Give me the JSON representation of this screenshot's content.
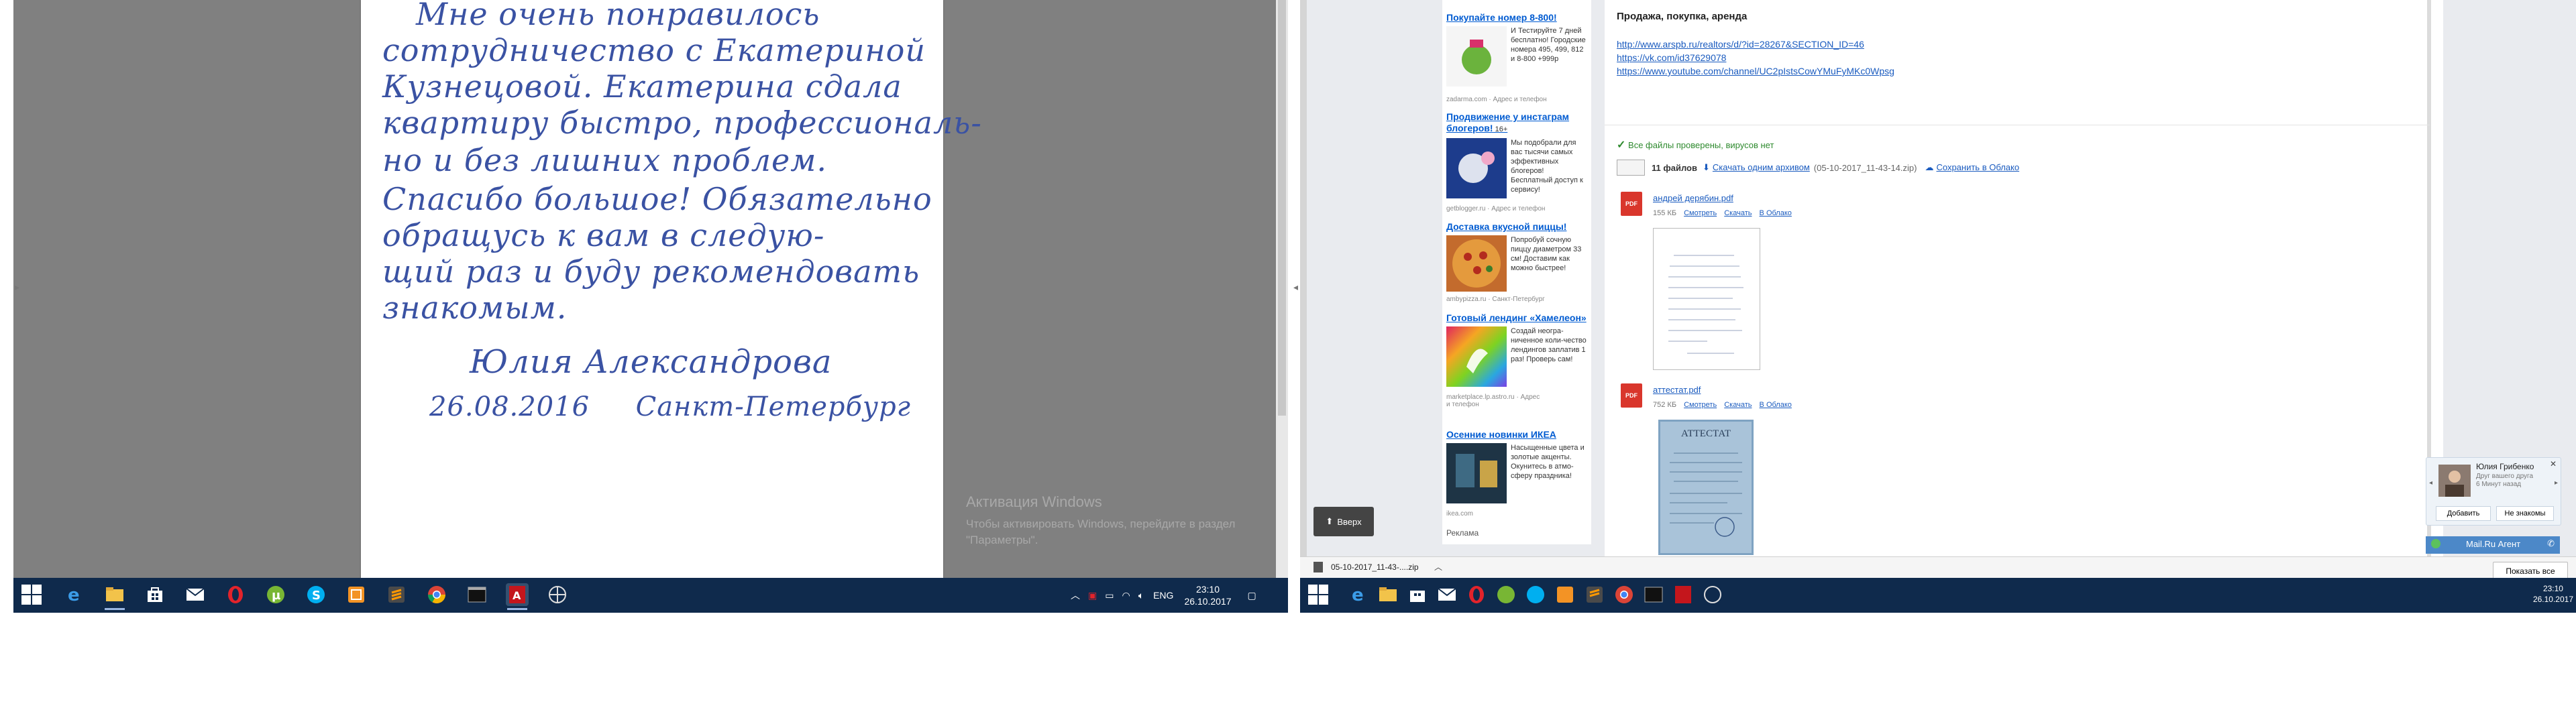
{
  "left_screen": {
    "letter_lines": [
      "Мне очень понравилось",
      "сотрудничество с Екатериной",
      "Кузнецовой. Екатерина сдала",
      "квартиру быстро, профессиональ-",
      "но и без лишних проблем.",
      "Спасибо большое! Обязательно",
      "обращусь к вам в следую-",
      "щий раз и буду рекомендовать",
      "знакомым."
    ],
    "signature": "Юлия Александрова",
    "date_place": "26.08.2016     Санкт-Петербург",
    "activation_title": "Активация Windows",
    "activation_text_1": "Чтобы активировать Windows, перейдите в раздел",
    "activation_text_2": "\"Параметры\".",
    "taskbar": {
      "lang": "ENG",
      "time": "23:10",
      "date": "26.10.2017"
    }
  },
  "right_screen": {
    "ads": [
      {
        "title": "Покупайте номер 8-800!",
        "text": "И Тестируйте 7 дней бесплатно! Городские номера 495, 499, 812 и 8-800 +999р",
        "source": "zadarma.com · Адрес и телефон"
      },
      {
        "title": "Продвижение у инстаграм блогеров!",
        "title_suffix": " 16+",
        "text": "Мы подобрали для вас тысячи самых эффективных блогеров! Бесплатный доступ к сервису!",
        "source": "getblogger.ru · Адрес и телефон"
      },
      {
        "title": "Доставка вкусной пиццы!",
        "text": "Попробуй сочную пиццу диаметром 33 см! Доставим как можно быстрее!",
        "source": "ambypizza.ru · Санкт-Петербург"
      },
      {
        "title": "Готовый лендинг «Хамелеон»",
        "text": "Создай неогра-ниченное коли-чество лендингов заплатив 1 раз! Проверь сам!",
        "source": "marketplace.lp.astro.ru · Адрес и телефон"
      },
      {
        "title": "Осенние новинки ИКЕА",
        "text": "Насыщенные цвета и золотые акценты. Окунитесь в атмо-сферу праздника!",
        "source": "ikea.com"
      }
    ],
    "ads_footer": "Реклама",
    "up_button": "Вверх",
    "mail": {
      "subject_line": "Продажа, покупка, аренда",
      "links": [
        "http://www.arspb.ru/realtors/d/?id=28267&SECTION_ID=46",
        "https://vk.com/id37629078",
        "https://www.youtube.com/channel/UC2pIstsCowYMuFyMKc0Wpsg"
      ],
      "virus_check": "Все файлы проверены, вирусов нет",
      "files_count": "11 файлов",
      "download_all": "Скачать одним архивом",
      "archive_name": "(05-10-2017_11-43-14.zip)",
      "save_cloud": "Сохранить в Облако",
      "files": [
        {
          "name": "андрей дерябин.pdf",
          "size": "155 КБ",
          "view": "Смотреть",
          "download": "Скачать",
          "cloud": "В Облако",
          "type": "PDF"
        },
        {
          "name": "аттестат.pdf",
          "size": "752 КБ",
          "view": "Смотреть",
          "download": "Скачать",
          "cloud": "В Облако",
          "type": "PDF"
        }
      ],
      "certificate_word": "АТТЕСТАТ"
    },
    "notification": {
      "name": "Юлия Грибенко",
      "message": "Друг вашего друга",
      "status": "6 Минут назад",
      "add_button": "Добавить",
      "decline_button": "Не знакомы"
    },
    "agent_bar": "Mail.Ru Агент",
    "download_item": "05-10-2017_11-43-....zip",
    "show_all": "Показать все",
    "taskbar": {
      "time": "23:10",
      "date": "26.10.2017"
    }
  },
  "colors": {
    "taskbar": "#0f2a4c",
    "ink": "#3a52a3",
    "link": "#1a5bbf",
    "ad_title": "#005bd1"
  }
}
